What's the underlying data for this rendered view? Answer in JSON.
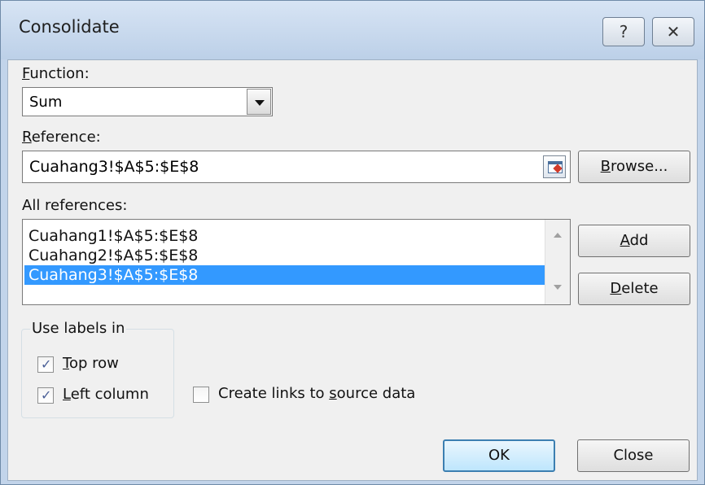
{
  "window": {
    "title": "Consolidate",
    "help_glyph": "?",
    "close_glyph": "✕"
  },
  "function": {
    "label_underline": "F",
    "label_rest": "unction:",
    "selected": "Sum"
  },
  "reference": {
    "label_underline": "R",
    "label_rest": "eference:",
    "value": "Cuahang3!$A$5:$E$8"
  },
  "buttons": {
    "browse_underline": "B",
    "browse_rest": "rowse...",
    "add_underline": "A",
    "add_rest": "dd",
    "delete_underline": "D",
    "delete_rest": "elete",
    "ok": "OK",
    "close": "Close"
  },
  "all_references": {
    "label": "All references:",
    "items": [
      "Cuahang1!$A$5:$E$8",
      "Cuahang2!$A$5:$E$8",
      "Cuahang3!$A$5:$E$8"
    ],
    "selected_index": 2
  },
  "labels_group": {
    "title": "Use labels in",
    "top_row_underline": "T",
    "top_row_rest": "op row",
    "top_row_checked": true,
    "left_column_underline": "L",
    "left_column_rest": "eft column",
    "left_column_checked": true
  },
  "links": {
    "label_pre": "Create links to ",
    "label_underline": "s",
    "label_post": "ource data",
    "checked": false
  },
  "colors": {
    "selection": "#3399ff",
    "default_button_border": "#3c7fb1"
  }
}
